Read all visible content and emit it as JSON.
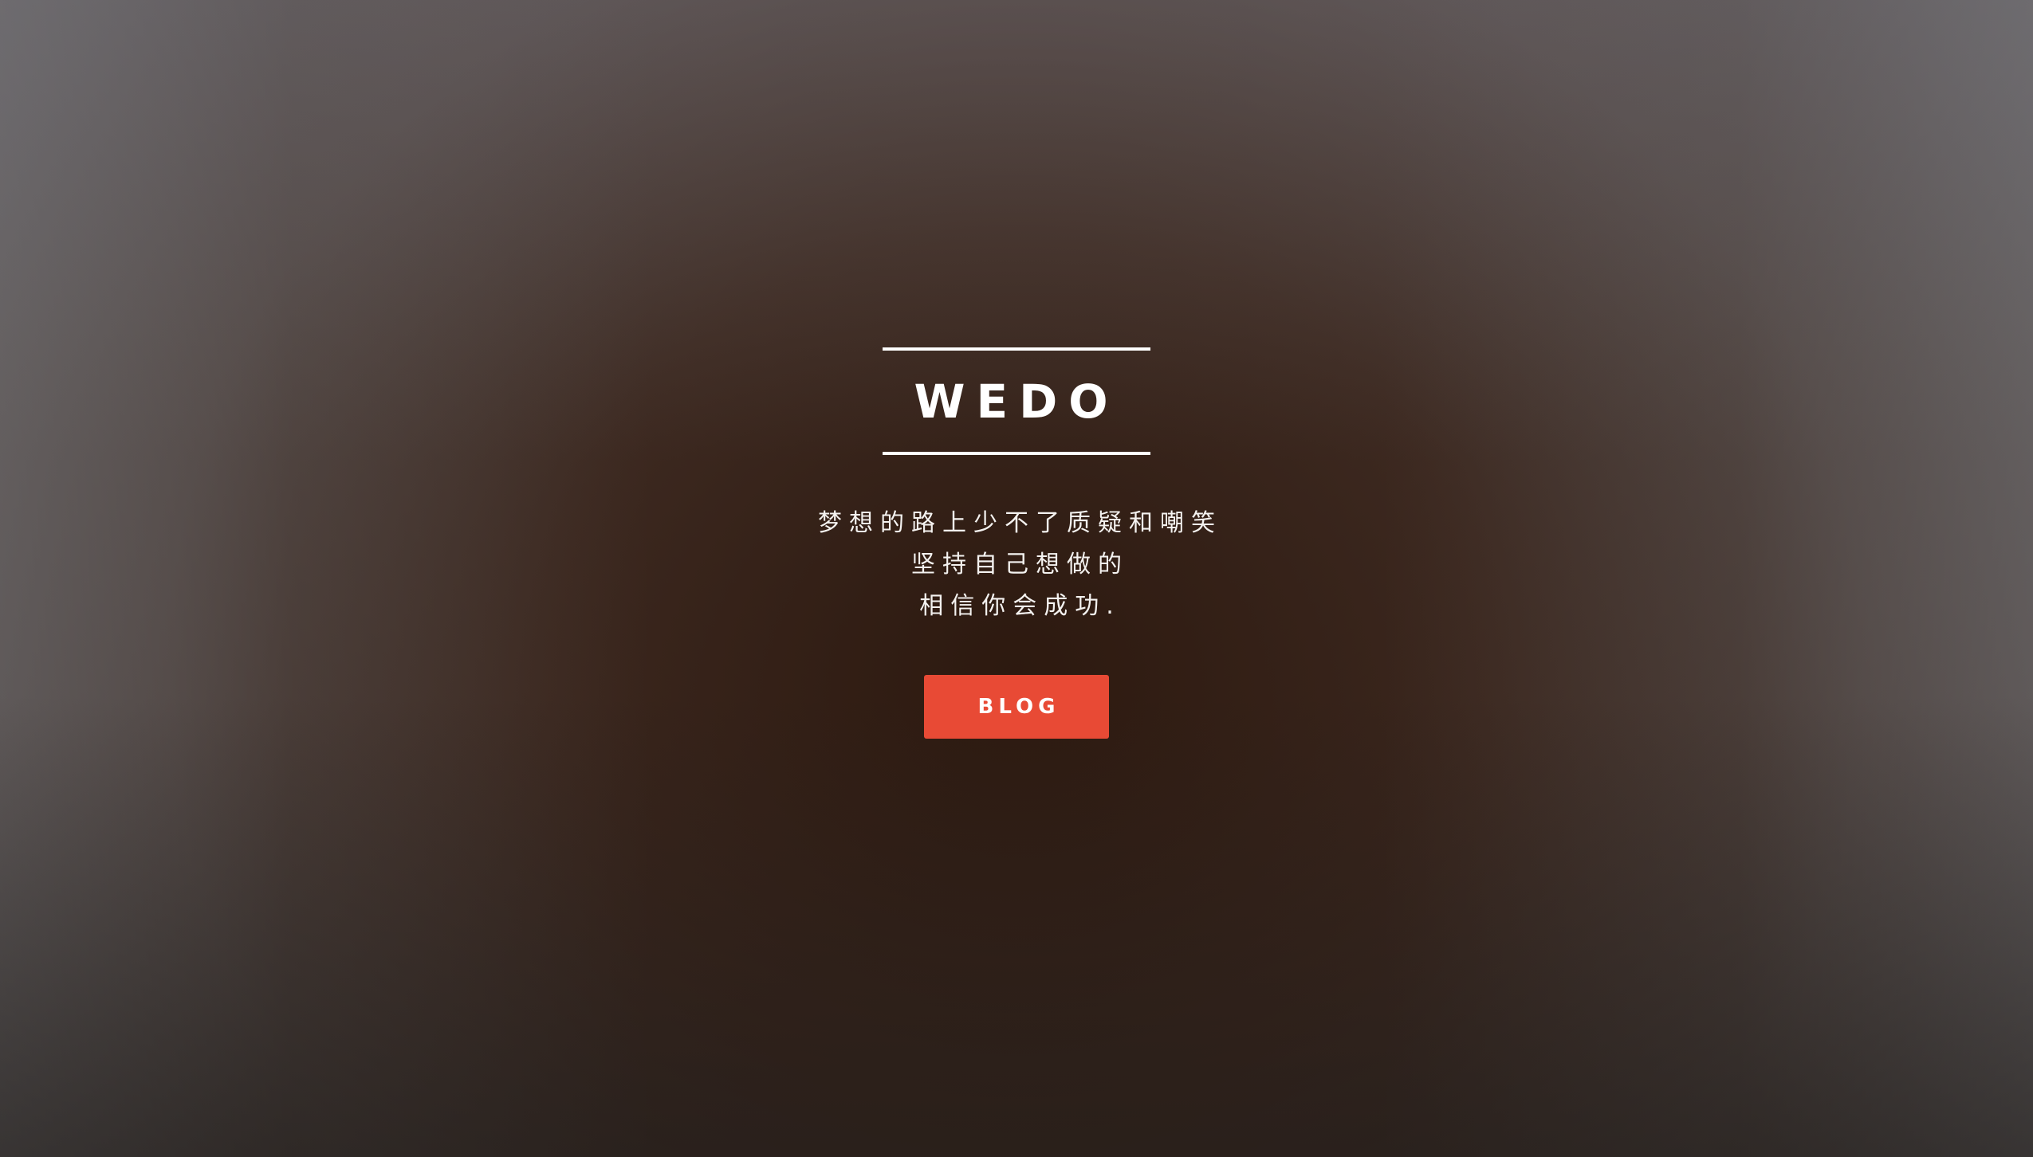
{
  "hero": {
    "title": "WEDO",
    "tagline": [
      "梦想的路上少不了质疑和嘲笑",
      "坚持自己想做的",
      "相信你会成功."
    ],
    "button_label": "BLOG"
  },
  "colors": {
    "button": "#e84a35",
    "text": "#ffffff",
    "background_center": "#2c180e",
    "background_edge": "#6e6c70"
  }
}
